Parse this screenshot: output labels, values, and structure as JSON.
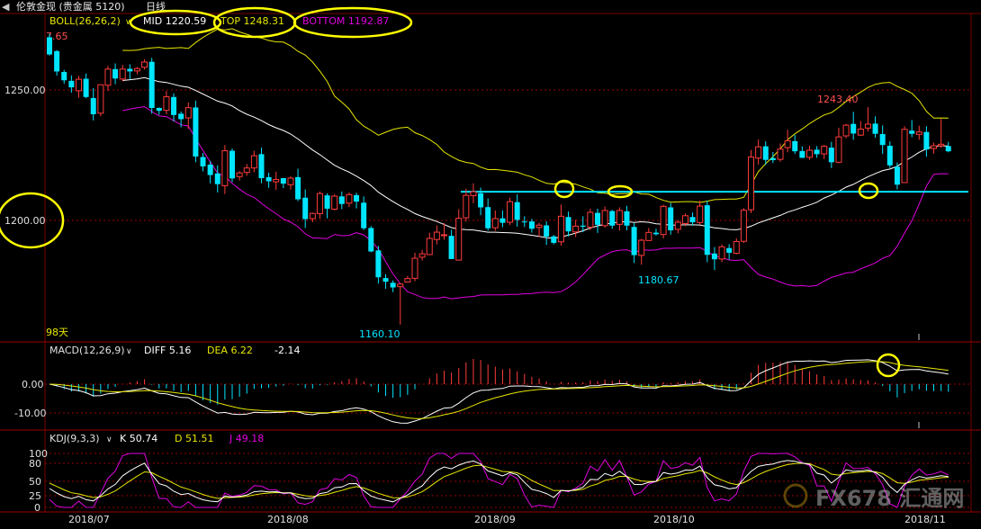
{
  "header": {
    "nav_icon": "arrow-left-icon",
    "title": "伦敦金现 (贵金属 5120)",
    "period": "日线"
  },
  "boll": {
    "label": "BOLL(26,26,2)",
    "mid": "MID 1220.59",
    "top": "TOP 1248.31",
    "bottom": "BOTTOM 1192.87"
  },
  "macd": {
    "label": "MACD(12,26,9)",
    "diff": "DIFF 5.16",
    "dea": "DEA 6.22",
    "macd_value": "-2.14"
  },
  "kdj": {
    "label": "KDJ(9,3,3)",
    "k": "K 50.74",
    "d": "D 51.51",
    "j": "J 49.18"
  },
  "watermark": "FX678 汇通网",
  "colors": {
    "up": "#ff3b3b",
    "down": "#00e5ff",
    "mid": "#ffffff",
    "top": "#e6e600",
    "bottom": "#e000e0",
    "hline": "#00e5ff",
    "highlight": "#ffff00",
    "axis": "#9a0000"
  },
  "chart_data": [
    {
      "type": "candlestick",
      "title": "伦敦金现 日线",
      "price_axis_labels": [
        "1250.00",
        "1200.00"
      ],
      "x_tick_labels": [
        "2018/07",
        "2018/08",
        "2018/09",
        "2018/10",
        "2018/11"
      ],
      "annotations": {
        "top_clip": "7.65",
        "high": "1243.40",
        "low": "1160.10",
        "low_oct": "1180.67",
        "bar_count": "98天"
      },
      "support_level": 1211,
      "candles": [
        [
          1270.2,
          1263.6,
          1271.5,
          1263.2
        ],
        [
          1264.9,
          1257.1,
          1265.3,
          1255.5
        ],
        [
          1256.9,
          1253.7,
          1257.7,
          1252.4
        ],
        [
          1253.5,
          1251.0,
          1255.6,
          1249.0
        ],
        [
          1249.7,
          1254.1,
          1255.4,
          1247.0
        ],
        [
          1254.3,
          1247.3,
          1256.3,
          1246.8
        ],
        [
          1246.9,
          1240.7,
          1250.7,
          1238.3
        ],
        [
          1241.1,
          1252.0,
          1252.2,
          1239.9
        ],
        [
          1251.8,
          1258.0,
          1259.2,
          1249.6
        ],
        [
          1258.0,
          1254.4,
          1260.2,
          1252.2
        ],
        [
          1254.2,
          1258.0,
          1259.6,
          1253.3
        ],
        [
          1258.1,
          1257.1,
          1259.8,
          1254.0
        ],
        [
          1257.3,
          1258.2,
          1258.8,
          1256.0
        ],
        [
          1258.7,
          1260.7,
          1261.8,
          1257.8
        ],
        [
          1260.8,
          1243.1,
          1262.3,
          1240.9
        ],
        [
          1243.1,
          1242.0,
          1243.3,
          1240.5
        ],
        [
          1242.2,
          1247.4,
          1249.6,
          1240.7
        ],
        [
          1247.3,
          1240.4,
          1248.7,
          1237.9
        ],
        [
          1240.9,
          1238.8,
          1241.8,
          1235.7
        ],
        [
          1239.3,
          1243.2,
          1245.2,
          1235.1
        ],
        [
          1243.3,
          1224.5,
          1245.9,
          1222.3
        ],
        [
          1224.3,
          1220.7,
          1225.8,
          1218.8
        ],
        [
          1221.4,
          1217.4,
          1222.8,
          1214.2
        ],
        [
          1218.0,
          1213.9,
          1221.1,
          1210.7
        ],
        [
          1213.3,
          1226.7,
          1228.9,
          1210.1
        ],
        [
          1226.7,
          1216.1,
          1227.6,
          1214.7
        ],
        [
          1216.8,
          1218.2,
          1218.9,
          1215.3
        ],
        [
          1218.4,
          1220.1,
          1221.6,
          1217.1
        ],
        [
          1220.1,
          1224.8,
          1226.7,
          1218.5
        ],
        [
          1225.4,
          1216.2,
          1227.9,
          1214.3
        ],
        [
          1216.6,
          1215.0,
          1218.3,
          1212.5
        ],
        [
          1214.8,
          1215.7,
          1218.7,
          1211.7
        ],
        [
          1216.2,
          1214.1,
          1216.3,
          1212.4
        ],
        [
          1213.7,
          1216.2,
          1216.9,
          1211.8
        ],
        [
          1216.6,
          1208.1,
          1219.8,
          1207.4
        ],
        [
          1208.7,
          1200.5,
          1211.9,
          1197.1
        ],
        [
          1200.7,
          1202.7,
          1203.0,
          1199.3
        ],
        [
          1202.6,
          1210.3,
          1211.1,
          1200.6
        ],
        [
          1209.6,
          1204.5,
          1210.4,
          1200.8
        ],
        [
          1204.3,
          1209.3,
          1210.1,
          1203.9
        ],
        [
          1209.2,
          1206.3,
          1211.1,
          1204.3
        ],
        [
          1206.6,
          1209.9,
          1210.7,
          1205.1
        ],
        [
          1209.7,
          1207.2,
          1210.6,
          1204.6
        ],
        [
          1206.8,
          1197.0,
          1209.2,
          1196.3
        ],
        [
          1197.1,
          1188.1,
          1197.8,
          1187.8
        ],
        [
          1188.5,
          1178.2,
          1190.2,
          1175.8
        ],
        [
          1177.9,
          1176.5,
          1179.4,
          1173.8
        ],
        [
          1176.1,
          1174.3,
          1177.0,
          1172.5
        ],
        [
          1174.6,
          1175.6,
          1176.0,
          1160.1
        ],
        [
          1176.4,
          1177.7,
          1178.7,
          1176.2
        ],
        [
          1177.8,
          1185.5,
          1187.6,
          1176.7
        ],
        [
          1185.9,
          1187.2,
          1188.7,
          1184.6
        ],
        [
          1186.9,
          1193.1,
          1195.3,
          1186.7
        ],
        [
          1192.7,
          1195.5,
          1198.1,
          1190.8
        ],
        [
          1194.2,
          1194.5,
          1199.0,
          1192.6
        ],
        [
          1194.1,
          1185.2,
          1196.4,
          1185.6
        ],
        [
          1184.8,
          1200.8,
          1204.3,
          1184.6
        ],
        [
          1201.0,
          1209.6,
          1212.2,
          1199.6
        ],
        [
          1209.5,
          1211.0,
          1214.2,
          1206.6
        ],
        [
          1210.4,
          1205.0,
          1212.6,
          1202.0
        ],
        [
          1205.1,
          1197.0,
          1208.4,
          1196.1
        ],
        [
          1197.2,
          1200.7,
          1203.8,
          1196.0
        ],
        [
          1200.8,
          1199.1,
          1203.8,
          1197.4
        ],
        [
          1199.3,
          1207.2,
          1208.7,
          1198.2
        ],
        [
          1207.0,
          1200.2,
          1210.0,
          1197.6
        ],
        [
          1199.6,
          1199.3,
          1201.6,
          1197.5
        ],
        [
          1199.6,
          1196.8,
          1200.6,
          1195.3
        ],
        [
          1197.3,
          1198.2,
          1199.1,
          1193.7
        ],
        [
          1198.1,
          1193.8,
          1199.6,
          1190.6
        ],
        [
          1193.9,
          1191.4,
          1194.4,
          1190.8
        ],
        [
          1191.8,
          1201.6,
          1206.1,
          1190.3
        ],
        [
          1201.3,
          1195.8,
          1203.4,
          1193.9
        ],
        [
          1195.6,
          1197.8,
          1200.2,
          1193.6
        ],
        [
          1198.0,
          1197.6,
          1201.6,
          1195.5
        ],
        [
          1197.4,
          1203.1,
          1204.5,
          1196.3
        ],
        [
          1202.9,
          1198.3,
          1204.5,
          1195.2
        ],
        [
          1198.0,
          1203.8,
          1205.3,
          1197.2
        ],
        [
          1203.6,
          1198.0,
          1204.0,
          1196.8
        ],
        [
          1198.5,
          1203.8,
          1205.0,
          1196.1
        ],
        [
          1203.5,
          1198.0,
          1205.6,
          1196.2
        ],
        [
          1197.5,
          1186.7,
          1199.0,
          1183.7
        ],
        [
          1186.6,
          1192.4,
          1193.0,
          1183.0
        ],
        [
          1192.3,
          1195.4,
          1197.1,
          1192.8
        ],
        [
          1195.3,
          1194.7,
          1196.8,
          1194.2
        ],
        [
          1194.6,
          1205.4,
          1206.0,
          1193.1
        ],
        [
          1205.0,
          1196.2,
          1206.7,
          1194.6
        ],
        [
          1196.6,
          1199.3,
          1200.2,
          1195.1
        ],
        [
          1198.8,
          1201.8,
          1202.7,
          1197.8
        ],
        [
          1201.3,
          1199.3,
          1203.0,
          1198.0
        ],
        [
          1199.2,
          1205.5,
          1207.6,
          1198.5
        ],
        [
          1205.8,
          1186.8,
          1207.6,
          1184.0
        ],
        [
          1187.3,
          1185.1,
          1189.8,
          1181.0
        ],
        [
          1185.2,
          1189.9,
          1190.8,
          1184.0
        ],
        [
          1189.4,
          1187.6,
          1190.9,
          1185.0
        ],
        [
          1187.4,
          1191.9,
          1193.1,
          1187.0
        ],
        [
          1192.0,
          1203.9,
          1204.7,
          1191.4
        ],
        [
          1204.1,
          1224.3,
          1227.0,
          1202.8
        ],
        [
          1223.9,
          1228.2,
          1231.0,
          1221.4
        ],
        [
          1228.4,
          1223.2,
          1230.3,
          1221.3
        ],
        [
          1223.9,
          1223.1,
          1226.2,
          1222.0
        ],
        [
          1223.4,
          1227.3,
          1229.5,
          1222.5
        ],
        [
          1227.9,
          1230.5,
          1234.7,
          1226.1
        ],
        [
          1230.4,
          1226.5,
          1232.8,
          1225.5
        ],
        [
          1226.6,
          1224.0,
          1228.4,
          1223.9
        ],
        [
          1224.2,
          1226.9,
          1228.6,
          1223.2
        ],
        [
          1227.1,
          1225.4,
          1228.5,
          1224.0
        ],
        [
          1225.5,
          1228.4,
          1228.9,
          1223.5
        ],
        [
          1227.9,
          1222.3,
          1230.1,
          1220.1
        ],
        [
          1222.3,
          1232.0,
          1235.5,
          1221.9
        ],
        [
          1232.4,
          1236.5,
          1237.0,
          1231.5
        ],
        [
          1237.0,
          1233.3,
          1241.6,
          1230.9
        ],
        [
          1232.7,
          1235.0,
          1238.1,
          1232.4
        ],
        [
          1235.4,
          1236.9,
          1243.4,
          1234.1
        ],
        [
          1237.1,
          1233.2,
          1239.9,
          1231.7
        ],
        [
          1233.1,
          1228.9,
          1236.4,
          1225.5
        ],
        [
          1228.6,
          1221.1,
          1230.3,
          1220.1
        ],
        [
          1220.6,
          1213.7,
          1222.2,
          1211.9
        ],
        [
          1214.5,
          1234.9,
          1236.1,
          1214.5
        ],
        [
          1234.4,
          1233.2,
          1238.5,
          1231.9
        ],
        [
          1233.0,
          1233.9,
          1236.3,
          1230.9
        ],
        [
          1233.9,
          1227.2,
          1236.1,
          1224.4
        ],
        [
          1227.6,
          1228.6,
          1229.8,
          1225.6
        ],
        [
          1228.6,
          1229.2,
          1238.9,
          1227.9
        ],
        [
          1228.5,
          1226.5,
          1230.1,
          1226.1
        ]
      ]
    },
    {
      "type": "line",
      "title": "MACD(12,26,9)",
      "y_tick_labels": [
        "0.00",
        "-10.00"
      ],
      "series": [
        {
          "name": "DIFF",
          "last": 5.16
        },
        {
          "name": "DEA",
          "last": 6.22
        },
        {
          "name": "MACD",
          "last": -2.14
        }
      ]
    },
    {
      "type": "line",
      "title": "KDJ(9,3,3)",
      "y_tick_labels": [
        "100",
        "80",
        "50",
        "25",
        "0"
      ],
      "series": [
        {
          "name": "K",
          "last": 50.74
        },
        {
          "name": "D",
          "last": 51.51
        },
        {
          "name": "J",
          "last": 49.18
        }
      ]
    }
  ]
}
